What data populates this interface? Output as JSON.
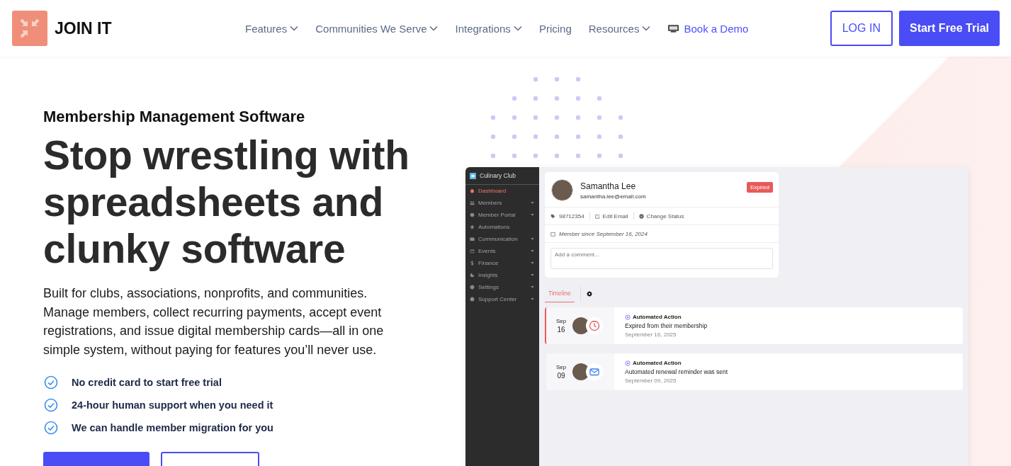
{
  "header": {
    "brand": "JOIN IT",
    "nav": [
      {
        "label": "Features",
        "kind": "dropdown"
      },
      {
        "label": "Communities We Serve",
        "kind": "dropdown"
      },
      {
        "label": "Integrations",
        "kind": "dropdown"
      },
      {
        "label": "Pricing",
        "kind": "link"
      },
      {
        "label": "Resources",
        "kind": "dropdown"
      },
      {
        "label": "Book a Demo",
        "kind": "demo"
      }
    ],
    "actions": [
      {
        "label": "LOG IN",
        "kind": "outline"
      },
      {
        "label": "Start Free Trial",
        "kind": "primary"
      }
    ]
  },
  "hero": {
    "eyebrow": "Membership Management Software",
    "headline": "Stop wrestling with spreadsheets and clunky software",
    "description": "Built for clubs, associations, nonprofits, and communities. Manage members, collect recurring payments, accept event registrations, and issue digital membership cards—all in one simple system, without paying for features you’ll never use.",
    "checks": [
      "No credit card to start free trial",
      "24-hour human support when you need it",
      "We can handle member migration for you"
    ],
    "cta_buttons": [
      {
        "kind": "primary"
      },
      {
        "kind": "outline"
      }
    ]
  },
  "app_preview": {
    "club_name": "Culinary Club",
    "sidebar": [
      {
        "label": "Dashboard",
        "selected": true,
        "has_submenu": false
      },
      {
        "label": "Members",
        "selected": false,
        "has_submenu": true
      },
      {
        "label": "Member Portal",
        "selected": false,
        "has_submenu": true
      },
      {
        "label": "Automations",
        "selected": false,
        "has_submenu": false
      },
      {
        "label": "Communication",
        "selected": false,
        "has_submenu": true
      },
      {
        "label": "Events",
        "selected": false,
        "has_submenu": true
      },
      {
        "label": "Finance",
        "selected": false,
        "has_submenu": true
      },
      {
        "label": "Insights",
        "selected": false,
        "has_submenu": true
      },
      {
        "label": "Settings",
        "selected": false,
        "has_submenu": true
      },
      {
        "label": "Support Center",
        "selected": false,
        "has_submenu": true
      }
    ],
    "profile": {
      "name": "Samantha Lee",
      "email": "samantha.lee@email.com",
      "status": "Expired",
      "member_id": "98712354",
      "edit_label": "Edit Email",
      "status_label": "Change Status",
      "member_since": "Member since September 16, 2024",
      "comment_placeholder": "Add a comment..."
    },
    "tabs": [
      {
        "label": "Timeline",
        "selected": true
      }
    ],
    "timeline": [
      {
        "kind": "expired",
        "highlighted": true,
        "month": "Sep",
        "day": "16",
        "tag": "Automated Action",
        "title": "Expired from their membership",
        "date": "September 16, 2025"
      },
      {
        "kind": "reminder",
        "highlighted": false,
        "month": "Sep",
        "day": "09",
        "tag": "Automated Action",
        "title": "Automated renewal reminder was sent",
        "date": "September 09, 2025"
      }
    ]
  }
}
